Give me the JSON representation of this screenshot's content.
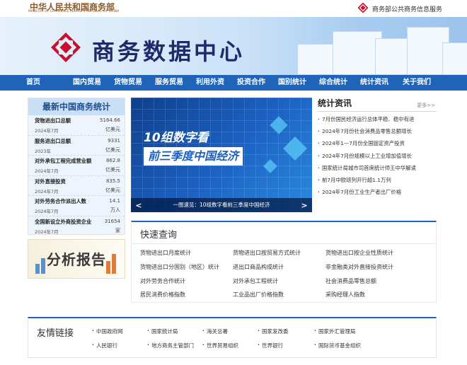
{
  "header": {
    "ministry_cn": "中华人民共和国商务部",
    "ministry_en": "MINISTRY OF COMMERCE PEOPLE'S REPUBLIC OF CHINA",
    "service_link": "商务部公共商务信息服务",
    "site_title": "商务数据中心",
    "logo_color": "#c8102e"
  },
  "nav": {
    "items": [
      "首页",
      "国内贸易",
      "货物贸易",
      "服务贸易",
      "利用外资",
      "投资合作",
      "国别统计",
      "综合统计",
      "统计资讯",
      "关于我们"
    ],
    "bar_color": "#1f64b8"
  },
  "stats": {
    "title": "最新中国商务统计",
    "items": [
      {
        "name": "货物进出口总额",
        "value": "5164.66",
        "year": "2024年7月",
        "unit": "亿美元"
      },
      {
        "name": "服务进出口总额",
        "value": "9331",
        "year": "2023年",
        "unit": "亿美元"
      },
      {
        "name": "对外承包工程完成营业额",
        "value": "862.8",
        "year": "2024年7月",
        "unit": "亿美元"
      },
      {
        "name": "对外直接投资",
        "value": "835.5",
        "year": "2024年7月",
        "unit": "亿美元"
      },
      {
        "name": "对外劳务合作派出人数",
        "value": "14.1",
        "year": "2024年7月",
        "unit": "万人"
      },
      {
        "name": "全国新设立外商投资企业",
        "value": "31654",
        "year": "2024年7月",
        "unit": "家"
      }
    ]
  },
  "analysis": {
    "label": "分析报告"
  },
  "slide": {
    "line1": "10组数字看",
    "line2": "前三季度中国经济",
    "caption": "一图速览：10组数字看前三季度中国经济",
    "prev": "<",
    "next": ">"
  },
  "news": {
    "title": "统计资讯",
    "more": "更多>>",
    "items": [
      "7月份国民经济运行总体平稳、稳中有进",
      "2024年7月份社会消费品零售总额增长",
      "2024年1—7月份全国固定资产投资",
      "2024年7月份规模以上工业增加值增长",
      "国家统计局城市司首席统计师王中华解读",
      "前7月中欧班列开行超1.1万列",
      "2024年7月份工业生产者出厂价格"
    ]
  },
  "quick": {
    "title": "快速查询",
    "links": [
      "货物进出口月度统计",
      "货物进出口按贸易方式统计",
      "货物进出口按企业性质统计",
      "货物进出口分国别（地区）统计",
      "进出口商品构成统计",
      "非金融类对外直接投资统计",
      "对外劳务合作统计",
      "对外承包工程统计",
      "社会消费品零售总额",
      "居民消费价格指数",
      "工业品出厂价格指数",
      "采购经理人指数"
    ]
  },
  "friends": {
    "title": "友情链接",
    "links": [
      "中国政府网",
      "国家统计局",
      "海关总署",
      "国家发改委",
      "国家外汇管理局",
      "人民银行",
      "地方商务主管部门",
      "世界贸易组织",
      "世界银行",
      "国际货币基金组织"
    ]
  }
}
